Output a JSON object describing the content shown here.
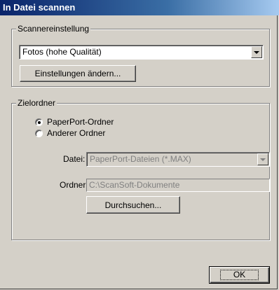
{
  "window": {
    "title": "In Datei scannen"
  },
  "scanner_settings": {
    "legend": "Scannereinstellung",
    "preset": {
      "value": "Fotos (hohe Qualität)"
    },
    "change_button": "Einstellungen ändern..."
  },
  "target": {
    "legend": "Zielordner",
    "radio_paperport": {
      "label": "PaperPort-Ordner",
      "checked": true
    },
    "radio_other": {
      "label": "Anderer Ordner",
      "checked": false
    },
    "file_label": "Datei:",
    "file_value": "PaperPort-Dateien (*.MAX)",
    "folder_label": "Ordner:",
    "folder_value": "C:\\ScanSoft-Dokumente",
    "browse_button": "Durchsuchen..."
  },
  "footer": {
    "ok_button": "OK"
  }
}
